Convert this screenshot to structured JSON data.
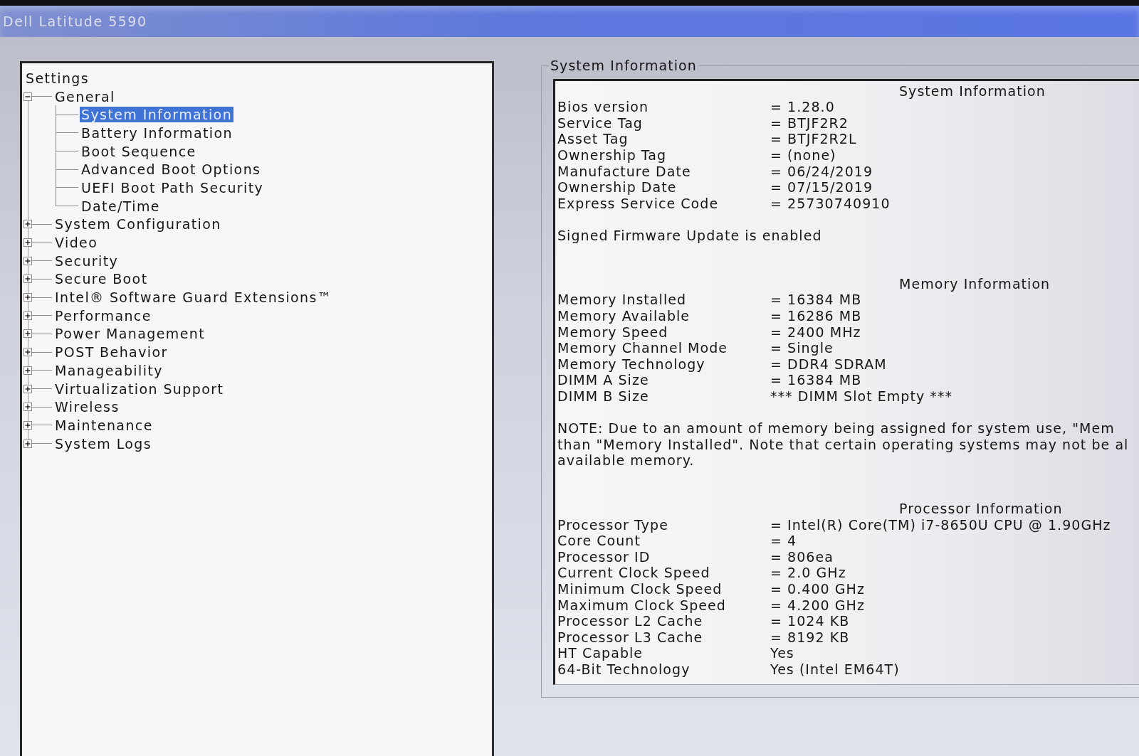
{
  "window": {
    "title": "Dell Latitude 5590"
  },
  "settings_tree": {
    "root_label": "Settings",
    "items": [
      {
        "label": "General",
        "expanded": true,
        "selected": false,
        "children": [
          {
            "label": "System Information",
            "selected": true
          },
          {
            "label": "Battery Information",
            "selected": false
          },
          {
            "label": "Boot Sequence",
            "selected": false
          },
          {
            "label": "Advanced Boot Options",
            "selected": false
          },
          {
            "label": "UEFI Boot Path Security",
            "selected": false
          },
          {
            "label": "Date/Time",
            "selected": false
          }
        ]
      },
      {
        "label": "System Configuration",
        "expanded": false,
        "selected": false
      },
      {
        "label": "Video",
        "expanded": false,
        "selected": false
      },
      {
        "label": "Security",
        "expanded": false,
        "selected": false
      },
      {
        "label": "Secure Boot",
        "expanded": false,
        "selected": false
      },
      {
        "label": "Intel® Software Guard Extensions™",
        "expanded": false,
        "selected": false
      },
      {
        "label": "Performance",
        "expanded": false,
        "selected": false
      },
      {
        "label": "Power Management",
        "expanded": false,
        "selected": false
      },
      {
        "label": "POST Behavior",
        "expanded": false,
        "selected": false
      },
      {
        "label": "Manageability",
        "expanded": false,
        "selected": false
      },
      {
        "label": "Virtualization Support",
        "expanded": false,
        "selected": false
      },
      {
        "label": "Wireless",
        "expanded": false,
        "selected": false
      },
      {
        "label": "Maintenance",
        "expanded": false,
        "selected": false
      },
      {
        "label": "System Logs",
        "expanded": false,
        "selected": false
      }
    ]
  },
  "system_information": {
    "group_title": "System Information",
    "sections": [
      {
        "kind": "table",
        "heading": "System Information",
        "rows": [
          {
            "label": "Bios version",
            "value": "= 1.28.0"
          },
          {
            "label": "Service Tag",
            "value": "= BTJF2R2"
          },
          {
            "label": "Asset Tag",
            "value": "= BTJF2R2L"
          },
          {
            "label": "Ownership Tag",
            "value": "= (none)"
          },
          {
            "label": "Manufacture Date",
            "value": "= 06/24/2019"
          },
          {
            "label": "Ownership Date",
            "value": "= 07/15/2019"
          },
          {
            "label": "Express Service Code",
            "value": "= 25730740910"
          }
        ]
      },
      {
        "kind": "text",
        "text": "Signed Firmware Update is enabled"
      },
      {
        "kind": "table",
        "heading": "Memory Information",
        "rows": [
          {
            "label": "Memory Installed",
            "value": "= 16384 MB"
          },
          {
            "label": "Memory Available",
            "value": "= 16286 MB"
          },
          {
            "label": "Memory Speed",
            "value": "= 2400 MHz"
          },
          {
            "label": "Memory Channel Mode",
            "value": "= Single"
          },
          {
            "label": "Memory Technology",
            "value": "= DDR4 SDRAM"
          },
          {
            "label": "DIMM A Size",
            "value": "= 16384 MB"
          },
          {
            "label": "DIMM B Size",
            "value": "*** DIMM Slot Empty ***"
          }
        ]
      },
      {
        "kind": "note",
        "lines": [
          "NOTE: Due to an amount of memory being assigned for system use, \"Mem",
          "than \"Memory Installed\". Note that certain operating systems may not be al",
          "available memory."
        ]
      },
      {
        "kind": "table",
        "heading": "Processor Information",
        "rows": [
          {
            "label": "Processor Type",
            "value": "= Intel(R) Core(TM) i7-8650U CPU @ 1.90GHz"
          },
          {
            "label": "Core Count",
            "value": "= 4"
          },
          {
            "label": "Processor ID",
            "value": "= 806ea"
          },
          {
            "label": "Current Clock Speed",
            "value": "= 2.0 GHz"
          },
          {
            "label": "Minimum Clock Speed",
            "value": "= 0.400 GHz"
          },
          {
            "label": "Maximum Clock Speed",
            "value": "= 4.200 GHz"
          },
          {
            "label": "Processor L2 Cache",
            "value": "= 1024 KB"
          },
          {
            "label": "Processor L3 Cache",
            "value": "= 8192 KB"
          },
          {
            "label": "HT Capable",
            "value": "Yes"
          },
          {
            "label": "64-Bit Technology",
            "value": "Yes (Intel EM64T)"
          }
        ]
      }
    ]
  }
}
